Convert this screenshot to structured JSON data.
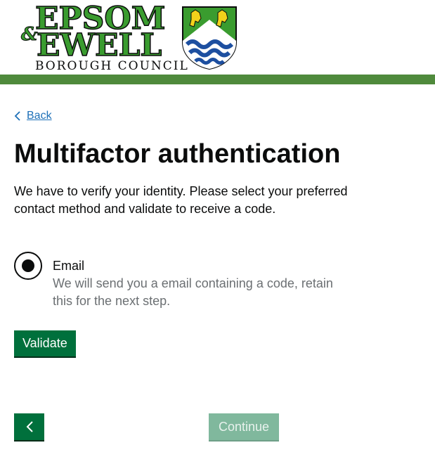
{
  "header": {
    "logo": {
      "line1": "EPSOM",
      "amp": "&",
      "line2": "EWELL",
      "line3": "BOROUGH COUNCIL"
    },
    "bar_color": "#4f8a3c"
  },
  "nav": {
    "back_label": "Back"
  },
  "main": {
    "title": "Multifactor authentication",
    "intro": "We have to verify your identity. Please select your preferred contact method and validate to receive a code.",
    "options": [
      {
        "label": "Email",
        "hint": "We will send you a email containing a code, retain this for the next step.",
        "selected": true
      }
    ],
    "validate_label": "Validate"
  },
  "footer": {
    "previous_icon": "chevron-left-icon",
    "continue_label": "Continue"
  },
  "colors": {
    "primary_green": "#00703c",
    "disabled_green": "#80b89d",
    "link_blue": "#1d70b8"
  }
}
